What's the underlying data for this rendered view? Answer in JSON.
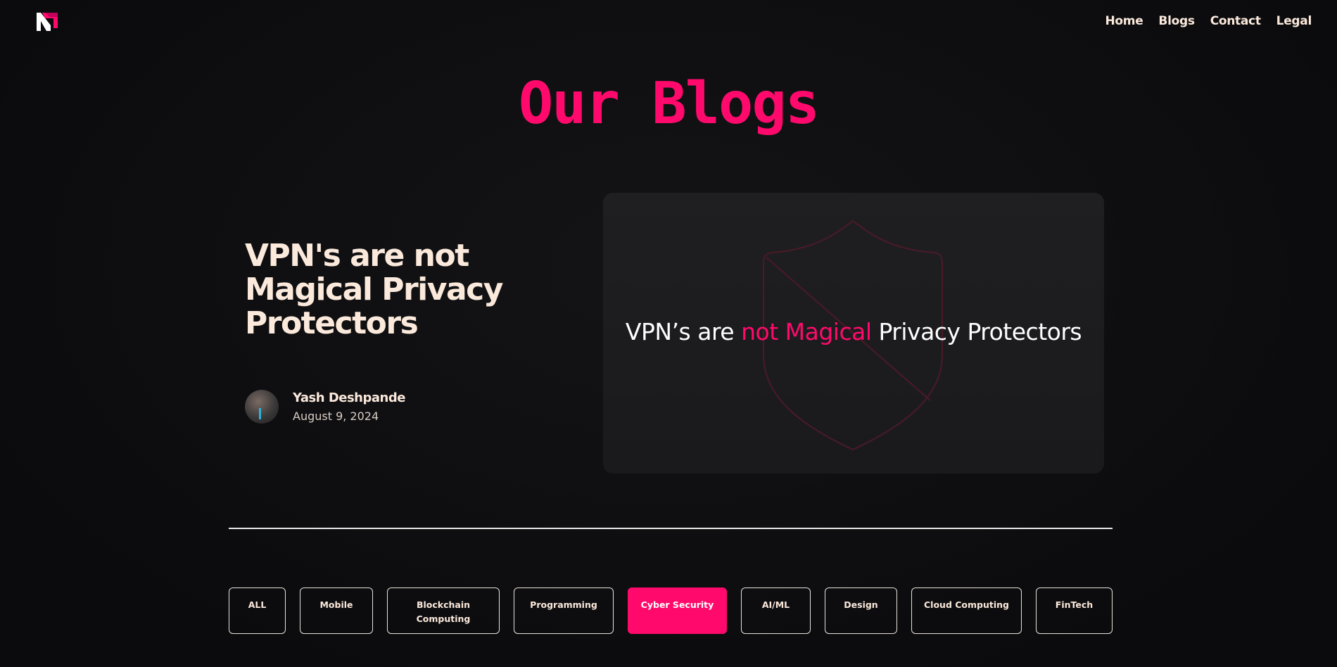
{
  "nav": {
    "items": [
      {
        "label": "Home"
      },
      {
        "label": "Blogs"
      },
      {
        "label": "Contact"
      },
      {
        "label": "Legal"
      }
    ]
  },
  "page_title": "Our Blogs",
  "featured": {
    "title": "VPN's are not Magical Privacy Protectors",
    "author_name": "Yash Deshpande",
    "date": "August 9, 2024",
    "card_text_before": "VPN’s are ",
    "card_text_highlight": "not Magical",
    "card_text_after": " Privacy Protectors"
  },
  "categories": [
    {
      "label": "ALL"
    },
    {
      "label": "Mobile"
    },
    {
      "label": "Blockchain Computing"
    },
    {
      "label": "Programming"
    },
    {
      "label": "Cyber Security",
      "active": true
    },
    {
      "label": "AI/ML"
    },
    {
      "label": "Design"
    },
    {
      "label": "Cloud Computing"
    },
    {
      "label": "FinTech"
    }
  ],
  "colors": {
    "accent": "#ff0a6c",
    "background": "#0d0d0f",
    "text": "#fbe9dc",
    "card": "#1f1f21"
  },
  "icons": {
    "logo": "brand-logo-icon",
    "shield": "shield-slash-icon"
  }
}
